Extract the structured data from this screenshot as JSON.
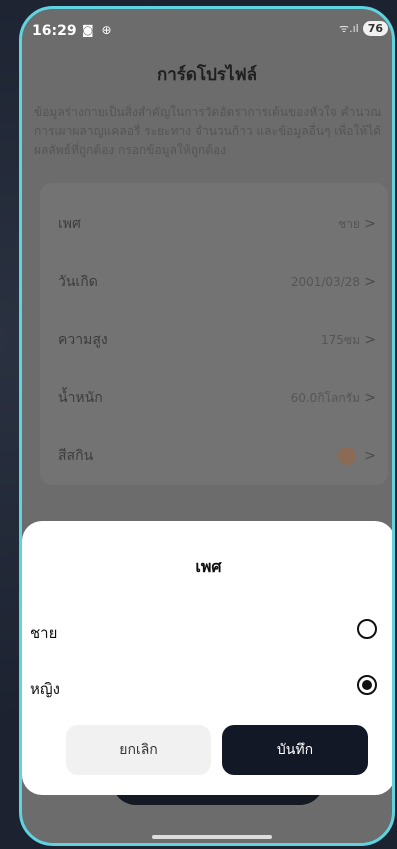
{
  "status_bar": {
    "time": "16:29",
    "battery": "76",
    "signal": "ᯤ.ıl"
  },
  "page": {
    "title": "การ์ดโปรไฟล์",
    "description": "ข้อมูลร่างกายเป็นสิ่งสำคัญในการวัดอัตราการเต้นของหัวใจ คำนวณการเผาผลาญแคลอรี่ ระยะทาง จำนวนก้าว และข้อมูลอื่นๆ เพื่อให้ได้ผลลัพธ์ที่ถูกต้อง กรอกข้อมูลให้ถูกต้อง"
  },
  "profile_rows": [
    {
      "label": "เพศ",
      "value": "ชาย"
    },
    {
      "label": "วันเกิด",
      "value": "2001/03/28"
    },
    {
      "label": "ความสูง",
      "value": "175ซม"
    },
    {
      "label": "น้ำหนัก",
      "value": "60.0กิโลกรัม"
    },
    {
      "label": "สีสกิน",
      "value": ""
    }
  ],
  "gender_sheet": {
    "title": "เพศ",
    "options": [
      {
        "label": "ชาย",
        "selected": false
      },
      {
        "label": "หญิง",
        "selected": true
      }
    ],
    "cancel_label": "ยกเลิก",
    "save_label": "บันทึก"
  },
  "colors": {
    "accent_border": "#5fd3e0",
    "primary_button": "#121826",
    "skin_tone": "#8b6b55"
  }
}
